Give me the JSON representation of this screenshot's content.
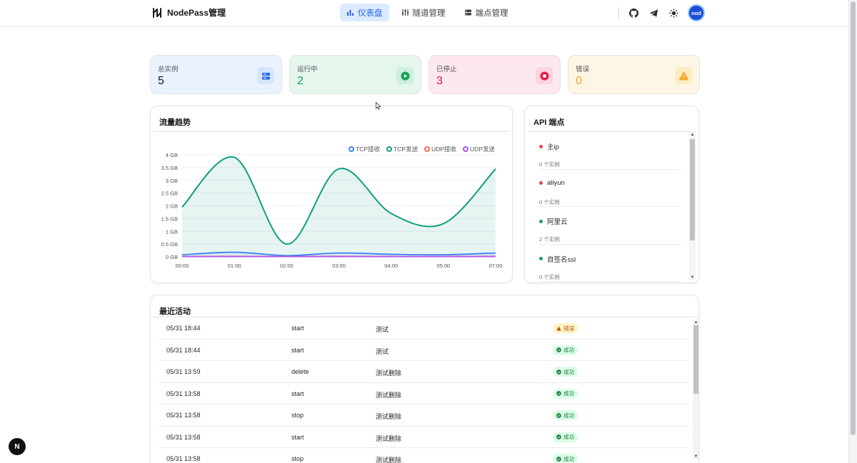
{
  "header": {
    "brand": "NodePass管理",
    "nav": [
      {
        "label": "仪表盘",
        "active": true
      },
      {
        "label": "隧道管理",
        "active": false
      },
      {
        "label": "端点管理",
        "active": false
      }
    ],
    "avatar": "nod",
    "icons": [
      "github-icon",
      "telegram-icon",
      "theme-toggle-icon"
    ]
  },
  "stats": [
    {
      "label": "总实例",
      "value": "5",
      "color": "#18181b",
      "bg": "#eaf2fe",
      "icon_bg": "#d6e4fd",
      "icon": "server-icon",
      "icon_color": "#2563eb"
    },
    {
      "label": "运行中",
      "value": "2",
      "color": "#17a35a",
      "bg": "#e5f6ec",
      "icon_bg": "#cdeedb",
      "icon": "play-icon",
      "icon_color": "#17a35a"
    },
    {
      "label": "已停止",
      "value": "3",
      "color": "#e11d48",
      "bg": "#fde8ed",
      "icon_bg": "#fbd4de",
      "icon": "stop-icon",
      "icon_color": "#e11d48"
    },
    {
      "label": "错误",
      "value": "0",
      "color": "#f5a524",
      "bg": "#fef6e4",
      "icon_bg": "#fdebc4",
      "icon": "warning-icon",
      "icon_color": "#f5a524"
    }
  ],
  "traffic": {
    "title": "流量趋势"
  },
  "chart_data": {
    "type": "area",
    "title": "流量趋势",
    "x": [
      "00:00",
      "01:00",
      "02:00",
      "03:00",
      "04:00",
      "05:00",
      "07:00"
    ],
    "y_ticks": [
      "0 GB",
      "0.5 GB",
      "1 GB",
      "1.5 GB",
      "2 GB",
      "2.5 GB",
      "3 GB",
      "3.5 GB",
      "4 GB"
    ],
    "ylim": [
      0,
      4
    ],
    "legend_position": "top-right",
    "series": [
      {
        "name": "TCP接收",
        "color": "#3b82f6",
        "values": [
          0.08,
          0.18,
          0.05,
          0.15,
          0.1,
          0.08,
          0.15
        ]
      },
      {
        "name": "TCP发送",
        "color": "#0e9f7e",
        "values": [
          1.95,
          3.9,
          0.5,
          3.45,
          1.7,
          1.3,
          3.45
        ]
      },
      {
        "name": "UDP接收",
        "color": "#ef6f5b",
        "values": [
          0.01,
          0.02,
          0.01,
          0.02,
          0.01,
          0.01,
          0.02
        ]
      },
      {
        "name": "UDP发送",
        "color": "#a855f7",
        "values": [
          0.01,
          0.01,
          0.01,
          0.01,
          0.01,
          0.01,
          0.01
        ]
      }
    ]
  },
  "endpoints": {
    "title": "API 端点",
    "items": [
      {
        "name": "主ip",
        "count": "0 个实例",
        "color": "#e5484d"
      },
      {
        "name": "aliyun",
        "count": "0 个实例",
        "color": "#e5484d"
      },
      {
        "name": "阿里云",
        "count": "2 个实例",
        "color": "#17a35a"
      },
      {
        "name": "自签名ssl",
        "count": "0 个实例",
        "color": "#17a35a"
      }
    ]
  },
  "activity": {
    "title": "最近活动",
    "rows": [
      {
        "time": "05/31 18:44",
        "action": "start",
        "name": "测试",
        "status": "错误",
        "type": "error"
      },
      {
        "time": "05/31 18:44",
        "action": "start",
        "name": "测试",
        "status": "成功",
        "type": "success"
      },
      {
        "time": "05/31 13:59",
        "action": "delete",
        "name": "测试删除",
        "status": "成功",
        "type": "success"
      },
      {
        "time": "05/31 13:58",
        "action": "start",
        "name": "测试删除",
        "status": "成功",
        "type": "success"
      },
      {
        "time": "05/31 13:58",
        "action": "stop",
        "name": "测试删除",
        "status": "成功",
        "type": "success"
      },
      {
        "time": "05/31 13:58",
        "action": "start",
        "name": "测试删除",
        "status": "成功",
        "type": "success"
      },
      {
        "time": "05/31 13:58",
        "action": "stop",
        "name": "测试删除",
        "status": "成功",
        "type": "success"
      }
    ]
  },
  "fab": "N"
}
